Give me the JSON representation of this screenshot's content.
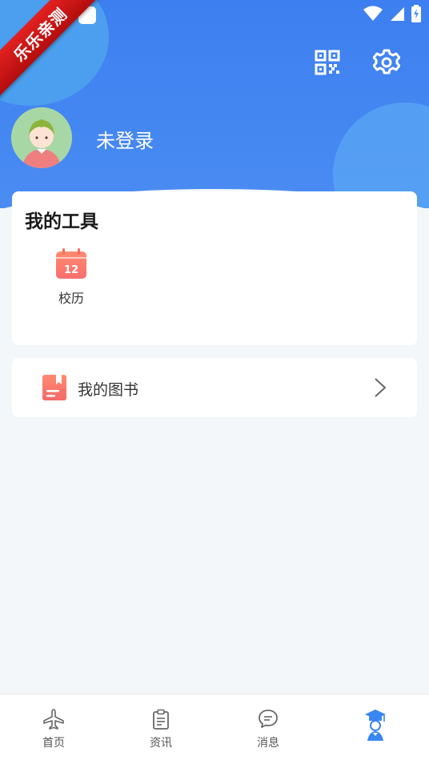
{
  "status": {
    "icons": [
      "wifi-icon",
      "signal-icon",
      "battery-charging-icon"
    ]
  },
  "watermark": {
    "text": "乐乐亲测"
  },
  "header": {
    "qr_icon": "qr-code-icon",
    "settings_icon": "gear-icon",
    "login_status": "未登录",
    "colors": {
      "primary": "#3d7ff0",
      "blob": "#4ea2ee"
    }
  },
  "tools": {
    "title": "我的工具",
    "items": [
      {
        "label": "校历",
        "icon": "calendar-icon",
        "badge": "12"
      }
    ]
  },
  "books": {
    "label": "我的图书",
    "icon": "book-icon"
  },
  "tabbar": {
    "items": [
      {
        "label": "首页",
        "icon": "airplane-icon"
      },
      {
        "label": "资讯",
        "icon": "clipboard-icon"
      },
      {
        "label": "消息",
        "icon": "chat-bubble-icon"
      },
      {
        "label": "",
        "icon": "graduate-icon",
        "active": true
      }
    ]
  }
}
